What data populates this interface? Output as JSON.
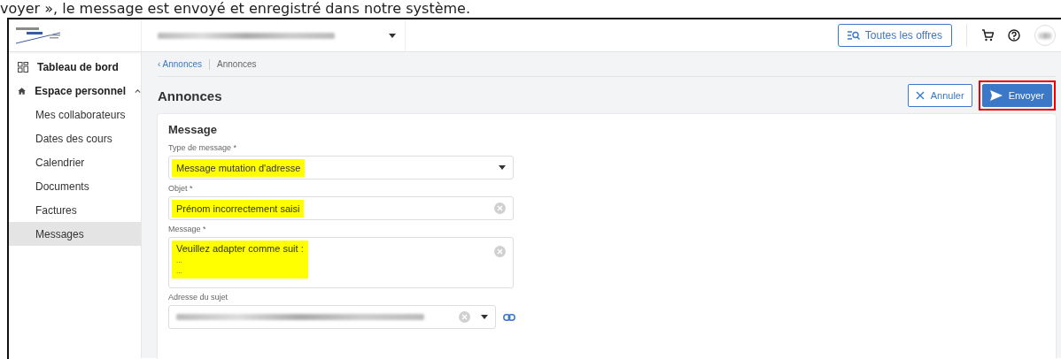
{
  "caption": "voyer », le message est envoyé et enregistré dans notre système.",
  "header": {
    "offers_button": "Toutes les offres"
  },
  "sidebar": {
    "items": [
      {
        "label": "Tableau de bord",
        "kind": "top",
        "selected": false
      },
      {
        "label": "Espace personnel",
        "kind": "group",
        "expanded": true,
        "selected": false,
        "children": [
          {
            "label": "Mes collaborateurs",
            "selected": false
          },
          {
            "label": "Dates des cours",
            "selected": false
          },
          {
            "label": "Calendrier",
            "selected": false
          },
          {
            "label": "Documents",
            "selected": false
          },
          {
            "label": "Factures",
            "selected": false
          },
          {
            "label": "Messages",
            "selected": true
          }
        ]
      }
    ]
  },
  "breadcrumb": [
    "‹ Annonces",
    "Annonces"
  ],
  "page_title": "Annonces",
  "actions": [
    {
      "label": "Annuler",
      "kind": "secondary",
      "highlighted": false
    },
    {
      "label": "Envoyer",
      "kind": "primary",
      "highlighted": true
    }
  ],
  "form": {
    "title": "Message",
    "fields": [
      {
        "label": "Type de message *",
        "kind": "select",
        "value": "Message mutation d'adresse",
        "highlighted": true
      },
      {
        "label": "Objet *",
        "kind": "text",
        "value": "Prénom incorrectement saisi",
        "highlighted": true
      },
      {
        "label": "Message *",
        "kind": "textarea",
        "lines": [
          "Veuillez adapter comme suit :",
          "...",
          "..."
        ],
        "highlighted": true
      },
      {
        "label": "Adresse du sujet",
        "kind": "redacted-select"
      }
    ]
  }
}
